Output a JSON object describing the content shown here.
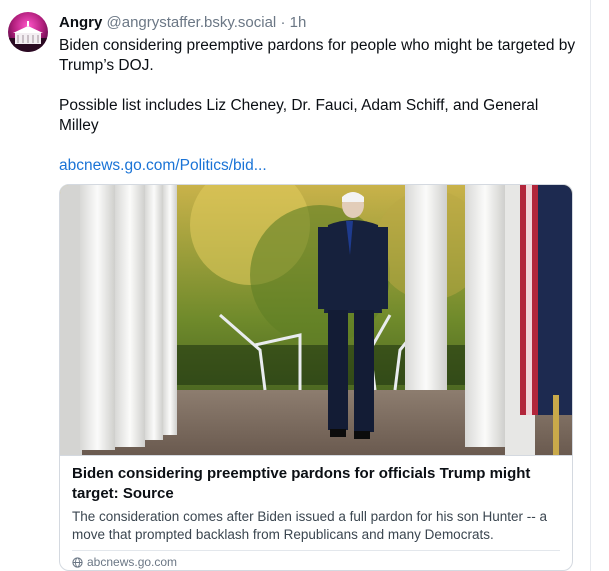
{
  "post": {
    "author_name": "Angry",
    "author_handle": "@angrystaffer.bsky.social",
    "separator": "·",
    "time": "1h",
    "text_paragraph_1": "Biden considering preemptive pardons for people who might be targeted by Trump’s DOJ.",
    "text_paragraph_2": "Possible list includes Liz Cheney, Dr. Fauci, Adam Schiff, and General Milley",
    "link_text": "abcnews.go.com/Politics/bid..."
  },
  "card": {
    "title": "Biden considering preemptive pardons for officials Trump might target: Source",
    "description": "The consideration comes after Biden issued a full pardon for his son Hunter -- a move that prompted backlash from Republicans and many Democrats.",
    "domain": "abcnews.go.com",
    "domain_icon": "globe-icon"
  },
  "colors": {
    "link": "#1a73d6",
    "muted": "#6b7785",
    "border": "#d4d9e0"
  }
}
